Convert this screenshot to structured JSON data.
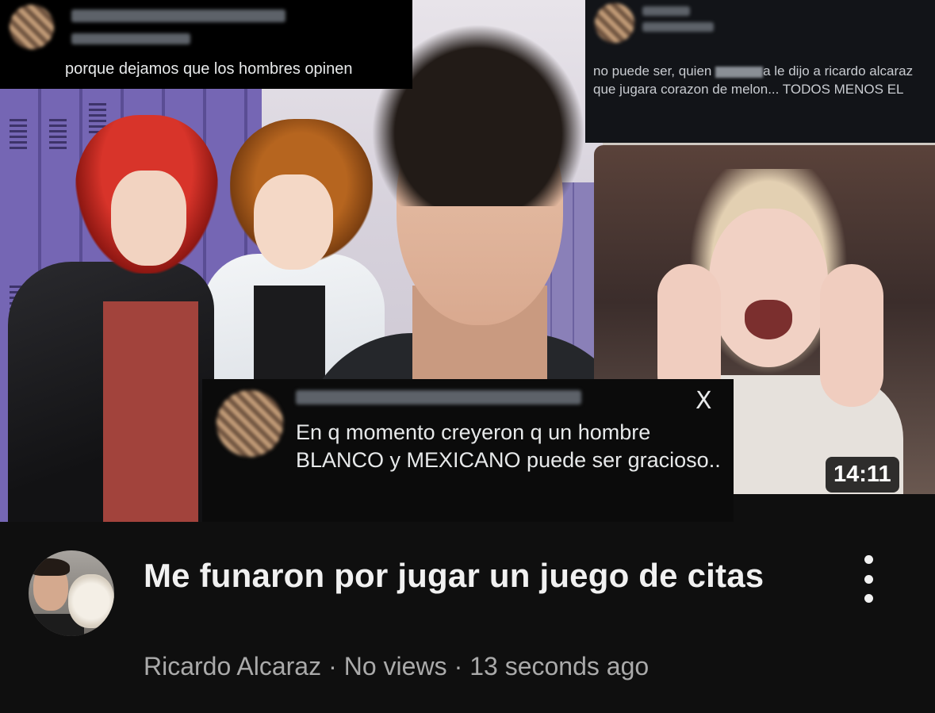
{
  "thumbnail": {
    "tweet_top_left": {
      "text": "porque dejamos que los hombres opinen"
    },
    "tweet_top_right": {
      "text_before": "no puede ser, quien",
      "text_after": "a le dijo a ricardo alcaraz que jugara corazon de melon... TODOS MENOS EL"
    },
    "tweet_bottom": {
      "text": "En q momento creyeron q un hombre BLANCO y MEXICANO puede ser gracioso..",
      "logo": "X"
    },
    "duration": "14:11"
  },
  "video": {
    "title": "Me funaron por jugar un juego de citas",
    "channel": "Ricardo Alcaraz",
    "separator": "·",
    "views": "No views",
    "age": "13 seconds ago"
  },
  "icons": {
    "more": "more-vert-icon",
    "x_logo": "x-logo-icon"
  },
  "colors": {
    "background": "#0f0f0f",
    "title": "#f1f1f1",
    "meta": "#aaaaaa"
  }
}
